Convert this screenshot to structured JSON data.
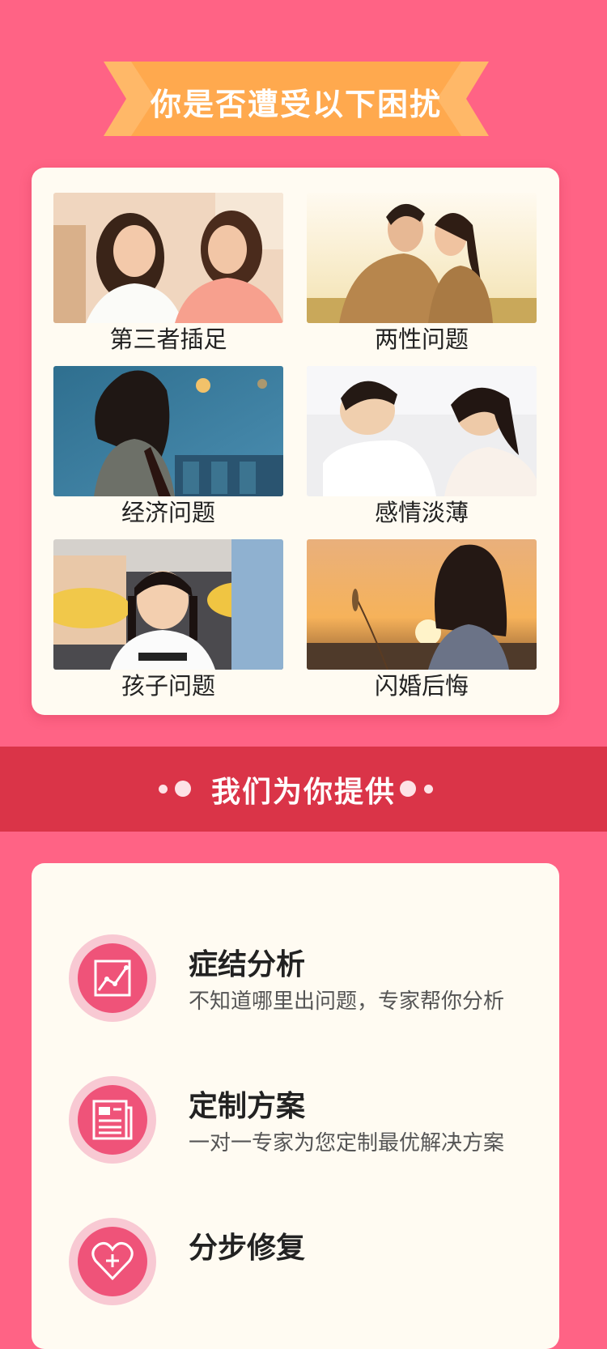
{
  "header": {
    "banner_title": "你是否遭受以下困扰"
  },
  "problems": [
    {
      "label": "第三者插足",
      "icon": "two-women-talking-photo"
    },
    {
      "label": "两性问题",
      "icon": "couple-embrace-photo"
    },
    {
      "label": "经济问题",
      "icon": "woman-dusk-city-photo"
    },
    {
      "label": "感情淡薄",
      "icon": "couple-sleeping-photo"
    },
    {
      "label": "孩子问题",
      "icon": "girl-with-tablet-photo"
    },
    {
      "label": "闪婚后悔",
      "icon": "woman-sunset-photo"
    }
  ],
  "offer": {
    "title": "我们为你提供"
  },
  "features": [
    {
      "title": "症结分析",
      "desc": "不知道哪里出问题，专家帮你分析",
      "icon": "line-chart-icon"
    },
    {
      "title": "定制方案",
      "desc": "一对一专家为您定制最优解决方案",
      "icon": "document-plan-icon"
    },
    {
      "title": "分步修复",
      "desc": "",
      "icon": "heart-plus-icon"
    }
  ],
  "colors": {
    "background": "#ff6385",
    "ribbon": "#ffab52",
    "band": "#da3448",
    "card": "#fffbf2",
    "icon_circle": "#ef5379"
  }
}
